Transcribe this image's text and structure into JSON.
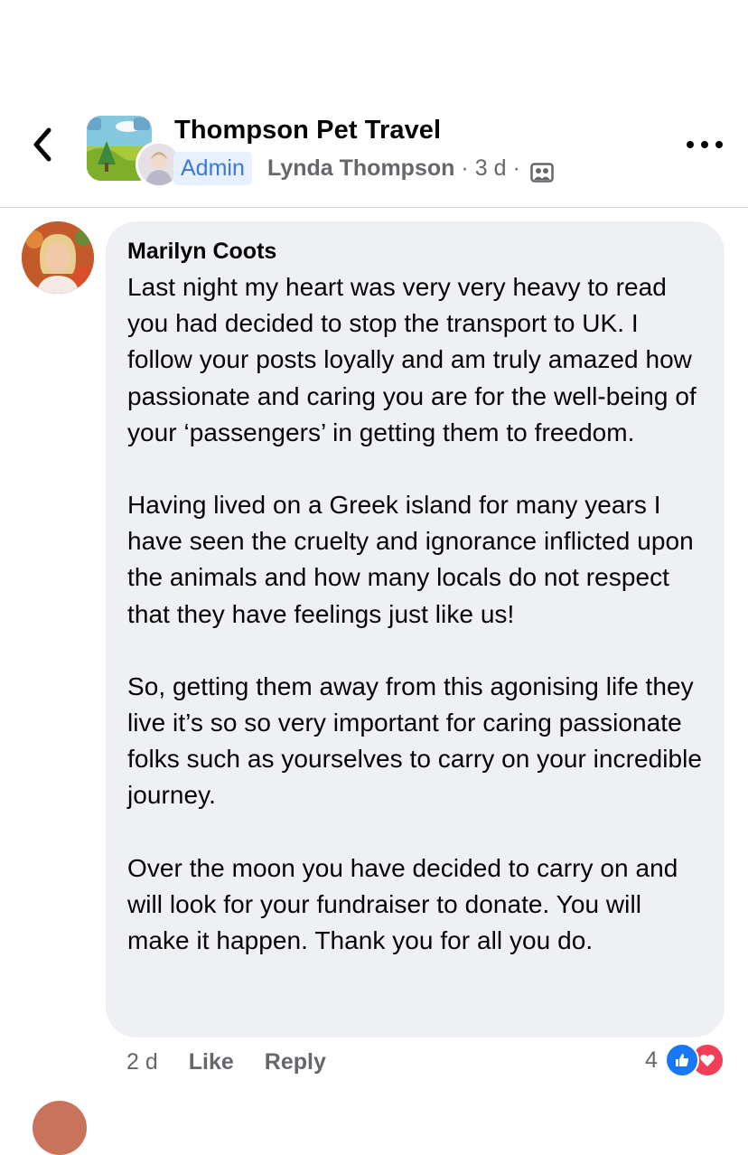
{
  "header": {
    "group_name": "Thompson Pet Travel",
    "role_badge": "Admin",
    "author": "Lynda Thompson",
    "separator": "·",
    "time": "3 d",
    "icons": {
      "back": "chevron-left-icon",
      "privacy": "group-privacy-icon",
      "more": "more-dots-icon"
    }
  },
  "comment": {
    "author": "Marilyn Coots",
    "paragraphs": [
      "Last night my heart was very very heavy to read you had decided to stop the transport to UK.  I follow your posts loyally and am truly amazed how passionate and caring you are for the well-being of your ‘passengers’ in getting them to freedom.",
      "Having lived on a Greek island for many years I have seen the cruelty and ignorance inflicted upon the animals and how many locals do not respect that they have feelings just like us!",
      "So, getting them away from this agonising life they live it’s so so very important for caring passionate folks such as yourselves to carry on your incredible journey.",
      "Over the moon you have decided to carry on and will look for your fundraiser to donate.  You will make it happen.  Thank you for all you do."
    ],
    "time": "2 d",
    "like_label": "Like",
    "reply_label": "Reply",
    "reaction_count": "4",
    "reactions": [
      "like-icon",
      "love-icon"
    ]
  },
  "colors": {
    "bubble": "#eff0f3",
    "secondary_text": "#65676b",
    "admin_badge_bg": "#e7f0fd",
    "admin_badge_text": "#3a78db",
    "like_blue": "#1877f2",
    "love_red": "#f33e58"
  }
}
